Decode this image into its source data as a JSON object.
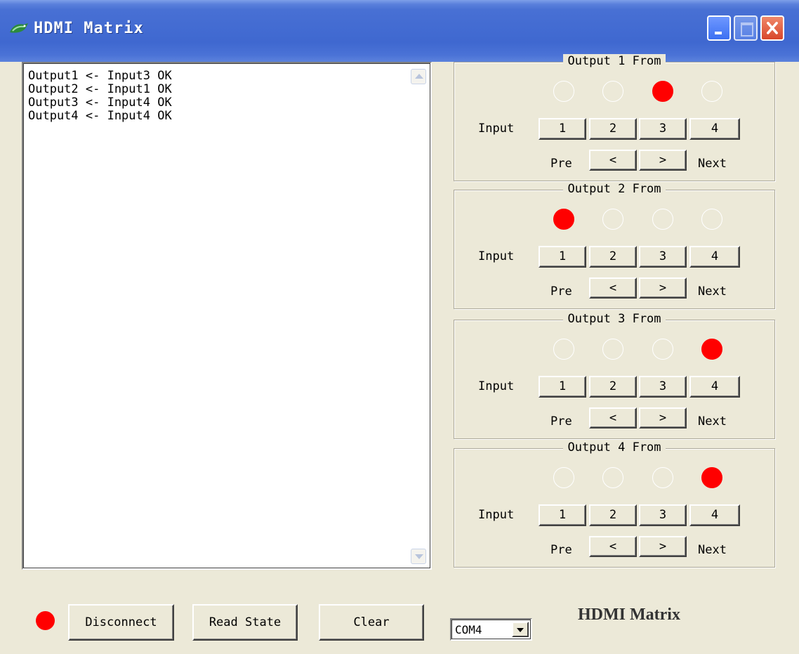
{
  "window": {
    "title": "HDMI Matrix"
  },
  "log": {
    "lines": [
      "Output1 <- Input3 OK",
      "Output2 <- Input1 OK",
      "Output3 <- Input4 OK",
      "Output4 <- Input4 OK"
    ]
  },
  "outputs": [
    {
      "title": "Output 1 From",
      "active_input": 3
    },
    {
      "title": "Output 2 From",
      "active_input": 1
    },
    {
      "title": "Output 3 From",
      "active_input": 4
    },
    {
      "title": "Output 4 From",
      "active_input": 4
    }
  ],
  "labels": {
    "input": "Input",
    "pre": "Pre",
    "next": "Next",
    "prev_arrow": "<",
    "next_arrow": ">"
  },
  "input_buttons": [
    "1",
    "2",
    "3",
    "4"
  ],
  "toolbar": {
    "disconnect": "Disconnect",
    "read_state": "Read State",
    "clear": "Clear"
  },
  "port": {
    "value": "COM4"
  },
  "brand": "HDMI Matrix",
  "colors": {
    "active_led": "#ff0000",
    "titlebar": "#3f68d0"
  }
}
